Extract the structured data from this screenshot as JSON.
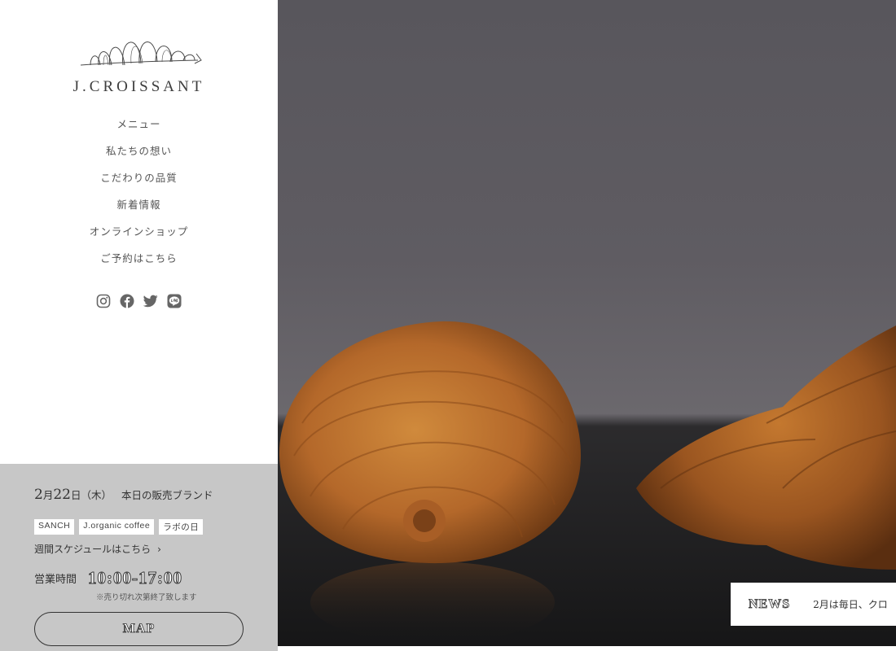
{
  "brand": {
    "name": "J.CROISSANT"
  },
  "nav": {
    "items": [
      {
        "label": "メニュー"
      },
      {
        "label": "私たちの想い"
      },
      {
        "label": "こだわりの品質"
      },
      {
        "label": "新着情報"
      },
      {
        "label": "オンラインショップ"
      },
      {
        "label": "ご予約はこちら"
      }
    ]
  },
  "social": {
    "icons": [
      "instagram-icon",
      "facebook-icon",
      "twitter-icon",
      "line-icon"
    ]
  },
  "today": {
    "month": "2",
    "month_suffix": "月",
    "day": "22",
    "day_suffix": "日（木）",
    "heading": "本日の販売ブランド",
    "brands": [
      "SANCH",
      "J.organic coffee",
      "ラボの日"
    ],
    "weekly_link": "週間スケジュールはこちら",
    "hours_label": "営業時間",
    "hours": "10:00-17:00",
    "note": "※売り切れ次第終了致します",
    "map_label": "MAP"
  },
  "news": {
    "title": "NEWS",
    "text": "2月は毎日、クロ"
  },
  "colors": {
    "info_panel": "#c7c7c7",
    "sidebar": "#ffffff",
    "text": "#444444"
  }
}
